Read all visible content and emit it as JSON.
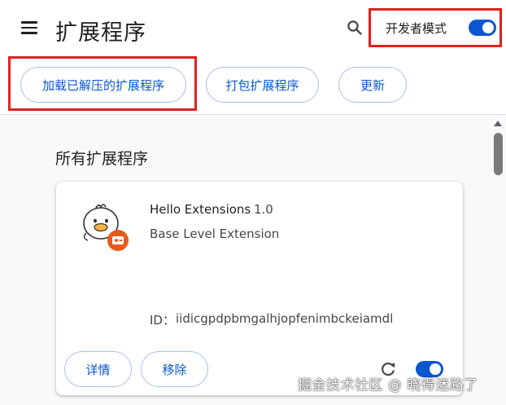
{
  "header": {
    "title": "扩展程序",
    "menu_icon": "menu-icon",
    "search_icon": "search-icon",
    "developer_mode_label": "开发者模式",
    "developer_mode_enabled": true
  },
  "actions": {
    "load_unpacked": "加载已解压的扩展程序",
    "pack": "打包扩展程序",
    "update": "更新"
  },
  "section": {
    "title": "所有扩展程序"
  },
  "extension": {
    "name": "Hello Extensions",
    "version": "1.0",
    "description": "Base Level Extension",
    "id_label": "ID：",
    "id_value": "iidicgpdpbmgalhjopfenimbckeiamdl",
    "details_label": "详情",
    "remove_label": "移除",
    "reload_icon": "reload-icon",
    "enabled": true
  },
  "watermark": "掘金技术社区 @ 晓得迷路了",
  "colors": {
    "accent": "#0b57d0",
    "highlight_border": "#e02020",
    "button_border": "#a8c0e8",
    "background": "#f8f9fb"
  }
}
